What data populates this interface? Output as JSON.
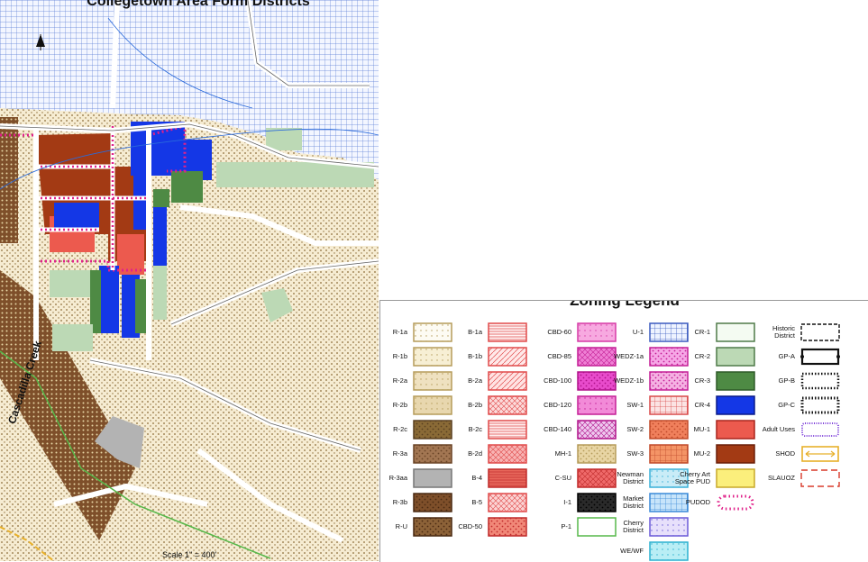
{
  "map": {
    "title": "Collegetown Area Form Districts",
    "north_label": "N",
    "creek_label": "Cascadilla Creek",
    "scale_label": "Scale 1\" = 400'"
  },
  "legend": {
    "title": "Zoning Legend",
    "items": [
      {
        "label": "R-1a",
        "fill": "#fdfbf3",
        "border": "#b59c5a",
        "pattern": "dots"
      },
      {
        "label": "R-1b",
        "fill": "#f7efd4",
        "border": "#b59c5a",
        "pattern": "dots"
      },
      {
        "label": "R-2a",
        "fill": "#efe1c0",
        "border": "#b59c5a",
        "pattern": "dots"
      },
      {
        "label": "R-2b",
        "fill": "#e8d7ae",
        "border": "#b59c5a",
        "pattern": "dots"
      },
      {
        "label": "R-2c",
        "fill": "#8a6a36",
        "border": "#5a4020",
        "pattern": "dense"
      },
      {
        "label": "R-3a",
        "fill": "#a27652",
        "border": "#6a4426",
        "pattern": "dense"
      },
      {
        "label": "R-3aa",
        "fill": "#b3b3b3",
        "border": "#777777",
        "pattern": "solid"
      },
      {
        "label": "R-3b",
        "fill": "#7e4f2a",
        "border": "#4a2a12",
        "pattern": "dense"
      },
      {
        "label": "R-U",
        "fill": "#8c6238",
        "border": "#4a2a12",
        "pattern": "dense"
      },
      {
        "label": "B-1a",
        "fill": "#fff2f2",
        "border": "#e04a4a",
        "pattern": "hlines"
      },
      {
        "label": "B-1b",
        "fill": "#ffe9e9",
        "border": "#e04a4a",
        "pattern": "diag"
      },
      {
        "label": "B-2a",
        "fill": "#ffe3e3",
        "border": "#e04a4a",
        "pattern": "diag"
      },
      {
        "label": "B-2b",
        "fill": "#fcdada",
        "border": "#e04a4a",
        "pattern": "cross"
      },
      {
        "label": "B-2c",
        "fill": "#ffeeee",
        "border": "#e04a4a",
        "pattern": "hlines"
      },
      {
        "label": "B-2d",
        "fill": "#f8b3b3",
        "border": "#e04a4a",
        "pattern": "cross"
      },
      {
        "label": "B-4",
        "fill": "#e8685c",
        "border": "#c02a2a",
        "pattern": "hlines"
      },
      {
        "label": "B-5",
        "fill": "#fbd3d3",
        "border": "#e04a4a",
        "pattern": "cross"
      },
      {
        "label": "CBD-50",
        "fill": "#f18878",
        "border": "#c02a2a",
        "pattern": "dense"
      },
      {
        "label": "CBD-60",
        "fill": "#f7a9e0",
        "border": "#d63aa6",
        "pattern": "dots"
      },
      {
        "label": "CBD-85",
        "fill": "#ef7fd4",
        "border": "#c41f96",
        "pattern": "cross"
      },
      {
        "label": "CBD-100",
        "fill": "#e84bcc",
        "border": "#b0128a",
        "pattern": "dense"
      },
      {
        "label": "CBD-120",
        "fill": "#f28ad8",
        "border": "#c41f96",
        "pattern": "dots"
      },
      {
        "label": "CBD-140",
        "fill": "#eec7ee",
        "border": "#b0128a",
        "pattern": "cross"
      },
      {
        "label": "MH-1",
        "fill": "#e8d5a4",
        "border": "#b59c5a",
        "pattern": "dense"
      },
      {
        "label": "C-SU",
        "fill": "#ef6a6a",
        "border": "#c02a2a",
        "pattern": "cross"
      },
      {
        "label": "I-1",
        "fill": "#2a2a2a",
        "border": "#000000",
        "pattern": "dense"
      },
      {
        "label": "P-1",
        "fill": "#ffffff",
        "border": "#57b84a",
        "pattern": "solid"
      },
      {
        "label": "U-1",
        "fill": "#eef3ff",
        "border": "#3b5bbf",
        "pattern": "grid"
      },
      {
        "label": "WEDZ-1a",
        "fill": "#f6a7e6",
        "border": "#c41f96",
        "pattern": "dense"
      },
      {
        "label": "WEDZ-1b",
        "fill": "#f5b2e3",
        "border": "#c41f96",
        "pattern": "dense"
      },
      {
        "label": "SW-1",
        "fill": "#fbe3e3",
        "border": "#d94a4a",
        "pattern": "grid"
      },
      {
        "label": "SW-2",
        "fill": "#f0805c",
        "border": "#c04a2a",
        "pattern": "dense"
      },
      {
        "label": "SW-3",
        "fill": "#f49466",
        "border": "#c04a2a",
        "pattern": "grid"
      },
      {
        "label": "Newman District",
        "fill": "#c9ecf7",
        "border": "#3ab0d8",
        "pattern": "dots"
      },
      {
        "label": "Market District",
        "fill": "#c7e4fa",
        "border": "#3a8ad8",
        "pattern": "grid"
      },
      {
        "label": "Cherry District",
        "fill": "#e7e0fb",
        "border": "#6a5ad8",
        "pattern": "dots"
      },
      {
        "label": "WE/WF",
        "fill": "#b9eef5",
        "border": "#2ab0d0",
        "pattern": "dots"
      },
      {
        "label": "CR-1",
        "fill": "#f4fbf2",
        "border": "#4e7a48",
        "pattern": "solid"
      },
      {
        "label": "CR-2",
        "fill": "#bcd9b5",
        "border": "#4e7a48",
        "pattern": "solid"
      },
      {
        "label": "CR-3",
        "fill": "#4e8a44",
        "border": "#2e5a28",
        "pattern": "solid"
      },
      {
        "label": "CR-4",
        "fill": "#1437e6",
        "border": "#0a1a8a",
        "pattern": "solid"
      },
      {
        "label": "MU-1",
        "fill": "#ec5a4e",
        "border": "#a8241c",
        "pattern": "solid"
      },
      {
        "label": "MU-2",
        "fill": "#a33a14",
        "border": "#6a1e08",
        "pattern": "solid"
      },
      {
        "label": "Cherry Art Space PUD",
        "fill": "#fbef7c",
        "border": "#c7a82a",
        "pattern": "solid"
      },
      {
        "label": "PUDOD",
        "fill": "#ffffff",
        "border": "#e0218a",
        "pattern": "beads"
      },
      {
        "label": "Historic District",
        "fill": "#ffffff",
        "border": "#111111",
        "pattern": "dashed"
      },
      {
        "label": "GP-A",
        "fill": "#ffffff",
        "border": "#111111",
        "pattern": "gpa"
      },
      {
        "label": "GP-B",
        "fill": "#ffffff",
        "border": "#111111",
        "pattern": "dotted"
      },
      {
        "label": "GP-C",
        "fill": "#ffffff",
        "border": "#111111",
        "pattern": "gpc"
      },
      {
        "label": "Adult Uses",
        "fill": "#ffffff",
        "border": "#7a3ad8",
        "pattern": "adult"
      },
      {
        "label": "SHOD",
        "fill": "#ffffff",
        "border": "#e8b02a",
        "pattern": "shod"
      },
      {
        "label": "SLAUOZ",
        "fill": "#ffffff",
        "border": "#d83a2a",
        "pattern": "longdash"
      }
    ]
  }
}
